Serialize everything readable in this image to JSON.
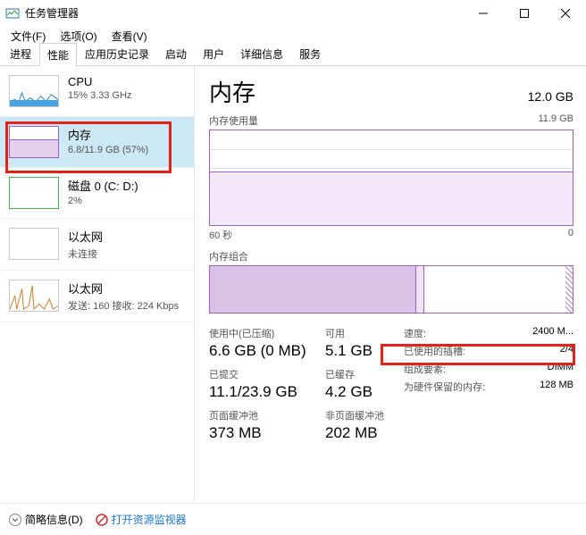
{
  "window": {
    "title": "任务管理器"
  },
  "menu": {
    "file": "文件(F)",
    "options": "选项(O)",
    "view": "查看(V)"
  },
  "tabs": [
    "进程",
    "性能",
    "应用历史记录",
    "启动",
    "用户",
    "详细信息",
    "服务"
  ],
  "active_tab": 1,
  "sidebar": {
    "items": [
      {
        "title": "CPU",
        "sub": "15% 3.33 GHz"
      },
      {
        "title": "内存",
        "sub": "6.8/11.9 GB (57%)"
      },
      {
        "title": "磁盘 0 (C: D:)",
        "sub": "2%"
      },
      {
        "title": "以太网",
        "sub": "未连接"
      },
      {
        "title": "以太网",
        "sub": "发送: 160 接收: 224 Kbps"
      }
    ]
  },
  "main": {
    "title": "内存",
    "total": "12.0 GB",
    "usage_chart_label": "内存使用量",
    "usage_chart_max": "11.9 GB",
    "axis_left": "60 秒",
    "axis_right": "0",
    "composition_label": "内存组合"
  },
  "stats": {
    "in_use_label": "使用中(已压缩)",
    "in_use_value": "6.6 GB (0 MB)",
    "available_label": "可用",
    "available_value": "5.1 GB",
    "committed_label": "已提交",
    "committed_value": "11.1/23.9 GB",
    "cached_label": "已缓存",
    "cached_value": "4.2 GB",
    "paged_label": "页面缓冲池",
    "paged_value": "373 MB",
    "nonpaged_label": "非页面缓冲池",
    "nonpaged_value": "202 MB"
  },
  "info": {
    "speed_k": "速度:",
    "speed_v": "2400 M...",
    "slots_k": "已使用的插槽:",
    "slots_v": "2/4",
    "form_k": "组成要素:",
    "form_v": "DIMM",
    "reserved_k": "为硬件保留的内存:",
    "reserved_v": "128 MB"
  },
  "footer": {
    "fewer": "简略信息(D)",
    "resmon": "打开资源监视器"
  },
  "chart_data": {
    "type": "area",
    "title": "内存使用量",
    "ylabel": "GB",
    "xlabel": "秒",
    "ylim": [
      0,
      11.9
    ],
    "x_range_seconds": 60,
    "series": [
      {
        "name": "内存使用量",
        "approx_constant_value": 6.8
      }
    ],
    "composition": {
      "in_use_gb": 6.6,
      "modified_gb": 0.2,
      "standby_gb": 4.2,
      "free_gb": 0.9,
      "hardware_reserved_mb": 128,
      "total_gb": 11.9
    }
  }
}
